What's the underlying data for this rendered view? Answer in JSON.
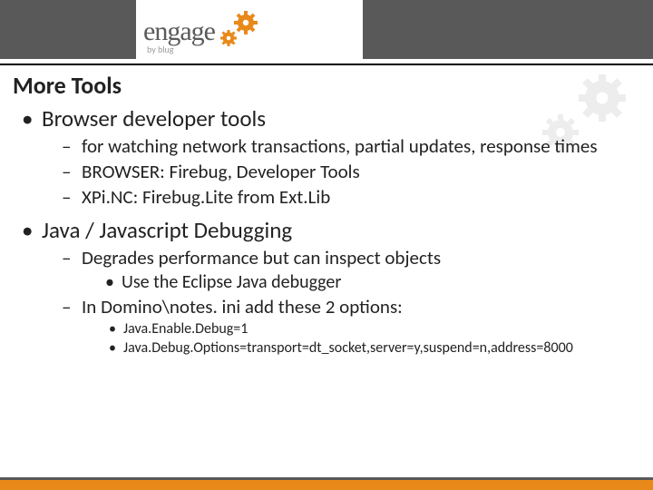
{
  "logo": {
    "text": "engage",
    "byline": "by blug"
  },
  "title": "More Tools",
  "bullets": [
    {
      "text": "Browser developer tools",
      "sub": [
        {
          "text": "for watching network transactions, partial updates, response times"
        },
        {
          "text": "BROWSER: Firebug, Developer Tools"
        },
        {
          "text": "XPi.NC: Firebug.Lite from Ext.Lib"
        }
      ]
    },
    {
      "text": "Java / Javascript Debugging",
      "sub": [
        {
          "text": "Degrades performance but can inspect objects",
          "sub3": [
            {
              "text": "Use the Eclipse Java debugger"
            }
          ]
        },
        {
          "text": "In Domino\\notes. ini add these 2 options:",
          "sub4": [
            {
              "text": "Java.Enable.Debug=1"
            },
            {
              "text": "Java.Debug.Options=transport=dt_socket,server=y,suspend=n,address=8000"
            }
          ]
        }
      ]
    }
  ]
}
